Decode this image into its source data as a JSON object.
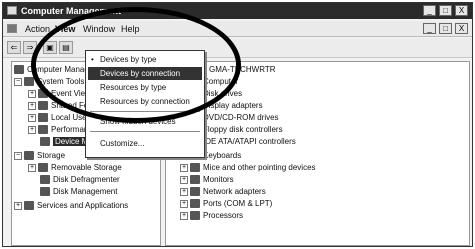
{
  "window": {
    "title": "Computer Management",
    "minimize": "_",
    "restore": "□",
    "close": "X"
  },
  "menubar": {
    "action": "Action",
    "view": "View",
    "window": "Window",
    "help": "Help"
  },
  "mdi": {
    "minimize": "_",
    "restore": "□",
    "close": "X"
  },
  "toolbar": {
    "back": "⇐",
    "forward": "⇒",
    "up": "▣",
    "props": "▤"
  },
  "view_menu": {
    "items": [
      {
        "label": "Devices by type",
        "checked": true
      },
      {
        "label": "Devices by connection",
        "highlighted": true
      },
      {
        "label": "Resources by type"
      },
      {
        "label": "Resources by connection"
      },
      {
        "label": "Show hidden devices"
      },
      {
        "label": "Customize..."
      }
    ],
    "check_mark": "•"
  },
  "tree": {
    "root": "Computer Management (Local)",
    "system_tools": "System Tools",
    "event_viewer": "Event Viewer",
    "shared_folders": "Shared Folders",
    "local_users": "Local Users and Groups",
    "performance": "Performance Logs and Alerts",
    "device_manager": "Device Manager",
    "storage": "Storage",
    "removable_storage": "Removable Storage",
    "disk_defragmenter": "Disk Defragmenter",
    "disk_management": "Disk Management",
    "services": "Services and Applications"
  },
  "devices": {
    "computer_name": "GMA-TECHWRTR",
    "items": [
      "Computer",
      "Disk drives",
      "Display adapters",
      "DVD/CD-ROM drives",
      "Floppy disk controllers",
      "IDE ATA/ATAPI controllers",
      "Keyboards",
      "Mice and other pointing devices",
      "Monitors",
      "Network adapters",
      "Ports (COM & LPT)",
      "Processors"
    ]
  }
}
